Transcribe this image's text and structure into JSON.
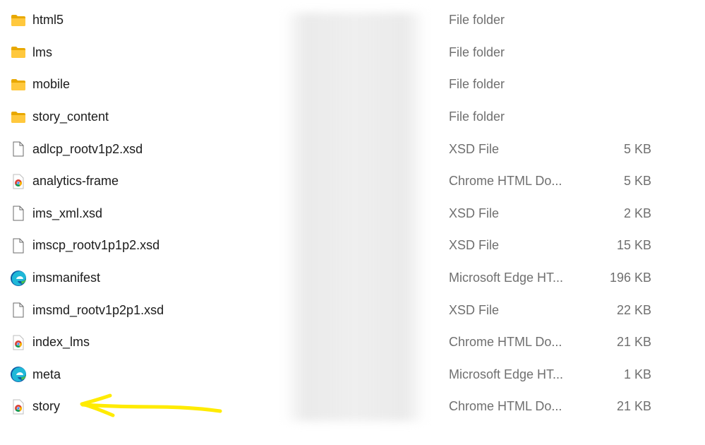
{
  "files": [
    {
      "name": "html5",
      "type": "File folder",
      "size": "",
      "icon": "folder-icon"
    },
    {
      "name": "lms",
      "type": "File folder",
      "size": "",
      "icon": "folder-icon"
    },
    {
      "name": "mobile",
      "type": "File folder",
      "size": "",
      "icon": "folder-icon"
    },
    {
      "name": "story_content",
      "type": "File folder",
      "size": "",
      "icon": "folder-icon"
    },
    {
      "name": "adlcp_rootv1p2.xsd",
      "type": "XSD File",
      "size": "5 KB",
      "icon": "file-icon"
    },
    {
      "name": "analytics-frame",
      "type": "Chrome HTML Do...",
      "size": "5 KB",
      "icon": "chrome-html-icon"
    },
    {
      "name": "ims_xml.xsd",
      "type": "XSD File",
      "size": "2 KB",
      "icon": "file-icon"
    },
    {
      "name": "imscp_rootv1p1p2.xsd",
      "type": "XSD File",
      "size": "15 KB",
      "icon": "file-icon"
    },
    {
      "name": "imsmanifest",
      "type": "Microsoft Edge HT...",
      "size": "196 KB",
      "icon": "edge-icon"
    },
    {
      "name": "imsmd_rootv1p2p1.xsd",
      "type": "XSD File",
      "size": "22 KB",
      "icon": "file-icon"
    },
    {
      "name": "index_lms",
      "type": "Chrome HTML Do...",
      "size": "21 KB",
      "icon": "chrome-html-icon"
    },
    {
      "name": "meta",
      "type": "Microsoft Edge HT...",
      "size": "1 KB",
      "icon": "edge-icon"
    },
    {
      "name": "story",
      "type": "Chrome HTML Do...",
      "size": "21 KB",
      "icon": "chrome-html-icon"
    }
  ],
  "colors": {
    "folder": "#f4c430",
    "arrow": "#ffeb00",
    "secondary_text": "#6f6f6f"
  }
}
